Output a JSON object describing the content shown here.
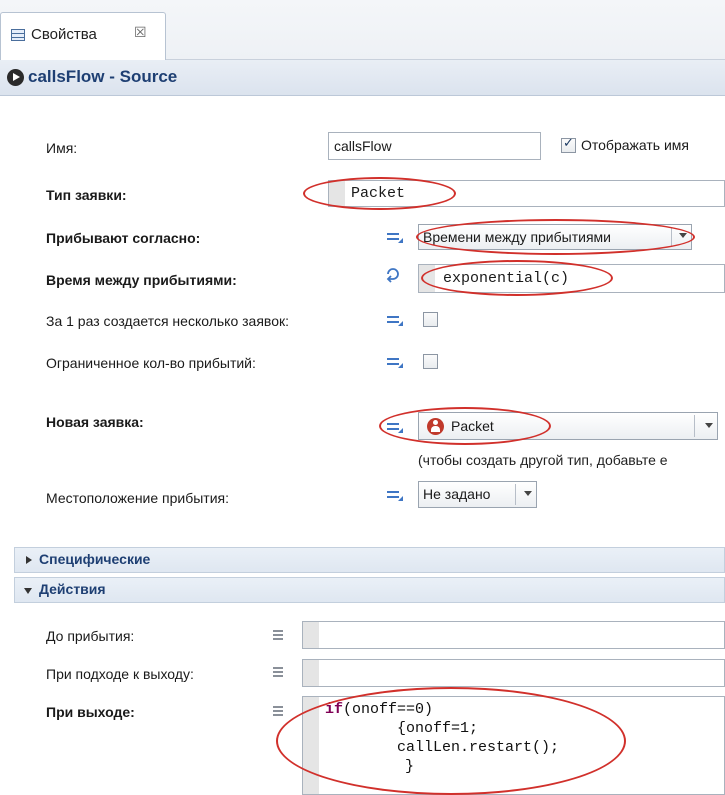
{
  "tab": {
    "label": "Свойства",
    "close_glyph": "☒",
    "icon": "properties-icon"
  },
  "header": {
    "title": "callsFlow - Source",
    "icon": "play-circle-icon"
  },
  "fields": {
    "name": {
      "label": "Имя:",
      "value": "callsFlow",
      "show_name_label": "Отображать имя",
      "show_name_checked": true
    },
    "agent_type": {
      "label": "Тип заявки:",
      "value": "Packet"
    },
    "arrivals_by": {
      "label": "Прибывают согласно:",
      "value": "Времени между прибытиями"
    },
    "interarrival": {
      "label": "Время между прибытиями:",
      "value": "exponential(c)"
    },
    "multiple": {
      "label": "За 1 раз создается несколько заявок:",
      "checked": false
    },
    "limited": {
      "label": "Ограниченное кол-во прибытий:",
      "checked": false
    },
    "new_agent": {
      "label": "Новая заявка:",
      "value": "Packet",
      "hint": "(чтобы создать другой тип, добавьте е"
    },
    "location": {
      "label": "Местоположение прибытия:",
      "value": "Не задано"
    }
  },
  "sections": {
    "specific": {
      "label": "Специфические",
      "expanded": false
    },
    "actions": {
      "label": "Действия",
      "expanded": true
    }
  },
  "actions": {
    "on_before_arrival": {
      "label": "До прибытия:",
      "code": ""
    },
    "on_at_exit": {
      "label": "При подходе к выходу:",
      "code": ""
    },
    "on_exit": {
      "label": "При выходе:",
      "keyword": "if",
      "line1_rest": "(onoff==0)",
      "line2": "{onoff=1;",
      "line3": "callLen.restart();",
      "line4": "}"
    }
  },
  "colors": {
    "accent_title": "#1e3f73",
    "annotation_red": "#d1302b",
    "keyword": "#7f0055"
  }
}
